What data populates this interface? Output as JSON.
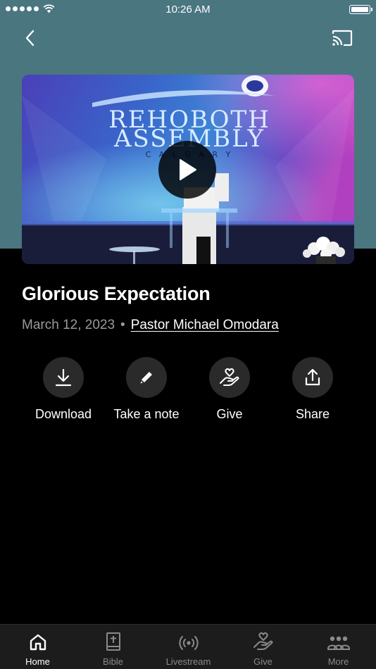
{
  "status_bar": {
    "time": "10:26 AM"
  },
  "video": {
    "slide_line1": "REHOBOTH",
    "slide_line2": "ASSEMBLY",
    "slide_line3": "C A L G A R Y"
  },
  "sermon": {
    "title": "Glorious Expectation",
    "date": "March 12, 2023",
    "separator": "•",
    "speaker": "Pastor Michael Omodara"
  },
  "actions": [
    {
      "label": "Download",
      "icon": "download-icon"
    },
    {
      "label": "Take a note",
      "icon": "pencil-icon"
    },
    {
      "label": "Give",
      "icon": "heart-hand-icon"
    },
    {
      "label": "Share",
      "icon": "share-icon"
    }
  ],
  "tabs": [
    {
      "label": "Home",
      "icon": "home-icon",
      "active": true
    },
    {
      "label": "Bible",
      "icon": "bible-icon",
      "active": false
    },
    {
      "label": "Livestream",
      "icon": "broadcast-icon",
      "active": false
    },
    {
      "label": "Give",
      "icon": "heart-hand-icon",
      "active": false
    },
    {
      "label": "More",
      "icon": "people-icon",
      "active": false
    }
  ],
  "colors": {
    "hero_background": "#4a7680",
    "page_background": "#000000",
    "action_circle": "#2a2a2a",
    "tab_bar": "#1c1c1c"
  }
}
